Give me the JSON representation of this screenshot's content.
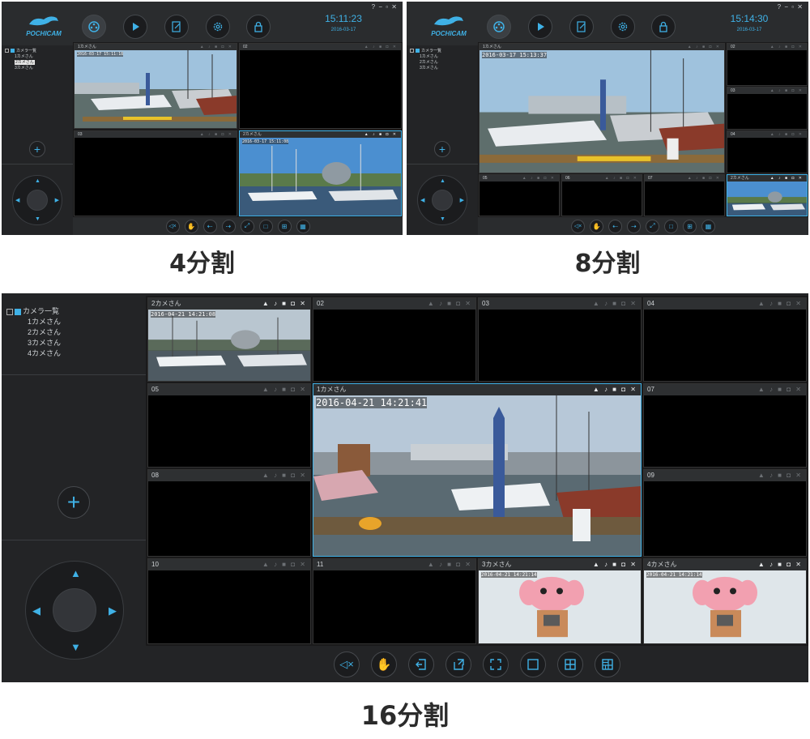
{
  "captions": {
    "four": "4分割",
    "eight": "8分割",
    "sixteen": "16分割"
  },
  "brand": {
    "logo_text": "POCHICAM",
    "accent": "#3fb1e6"
  },
  "window_controls": "? − ▫ ✕",
  "four_split": {
    "time": "15:11:23",
    "date": "2016-03-17",
    "tree": {
      "root": "カメラ一覧",
      "items": [
        "1カメさん",
        "2カメさん",
        "3カメさん"
      ]
    },
    "tiles": [
      {
        "label": "1カメさん",
        "timestamp": "2016-03-17 15:11:18"
      },
      {
        "label": "02",
        "timestamp": ""
      },
      {
        "label": "03",
        "timestamp": ""
      },
      {
        "label": "2カメさん",
        "timestamp": "2016-03-17 15:11:08"
      }
    ]
  },
  "eight_split": {
    "time": "15:14:30",
    "date": "2016-03-17",
    "tree": {
      "root": "カメラ一覧",
      "items": [
        "1カメさん",
        "2カメさん",
        "3カメさん"
      ]
    },
    "tiles": [
      {
        "label": "1カメさん",
        "timestamp": "2016-03-17 15:13:37"
      },
      {
        "label": "02"
      },
      {
        "label": "03"
      },
      {
        "label": "04"
      },
      {
        "label": "05"
      },
      {
        "label": "06"
      },
      {
        "label": "07"
      },
      {
        "label": "2カメさん"
      }
    ]
  },
  "sixteen_split": {
    "tree": {
      "root": "カメラ一覧",
      "items": [
        "1カメさん",
        "2カメさん",
        "3カメさん",
        "4カメさん"
      ]
    },
    "tiles": [
      {
        "label": "2カメさん",
        "timestamp": "2016-04-21 14:21:08"
      },
      {
        "label": "02"
      },
      {
        "label": "03"
      },
      {
        "label": "04"
      },
      {
        "label": "05"
      },
      {
        "label": "1カメさん",
        "timestamp": "2016-04-21 14:21:41"
      },
      {
        "label": "07"
      },
      {
        "label": "08"
      },
      {
        "label": "09"
      },
      {
        "label": "10"
      },
      {
        "label": "11"
      },
      {
        "label": "3カメさん",
        "timestamp": "2016-04-21 14:21:14"
      },
      {
        "label": "4カメさん",
        "timestamp": "2016-04-21 14:21:14"
      }
    ]
  },
  "tile_icons": "▲ ♪ ■ ◘ ✕",
  "toolbar_icons": [
    "mute-icon",
    "hand-icon",
    "import-icon",
    "export-icon",
    "fullscreen-icon",
    "single-view-icon",
    "four-split-icon",
    "multi-split-icon"
  ]
}
